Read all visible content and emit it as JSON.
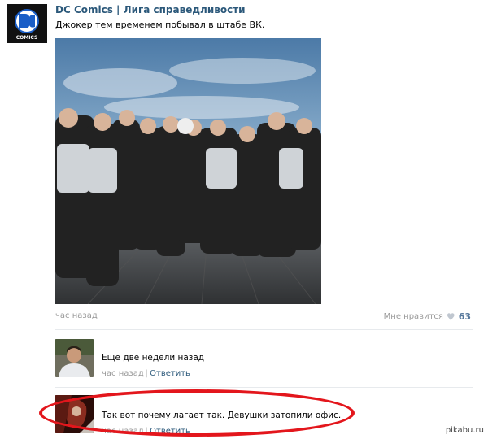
{
  "post": {
    "author": "DC Comics | Лига справедливости",
    "logo_text_1": "DC",
    "logo_text_2": "COMICS",
    "text": "Джокер тем временем побывал в штабе ВК.",
    "time": "час назад",
    "like_label": "Мне нравится",
    "like_count": "63",
    "photo_alt": "group-photo"
  },
  "comments": [
    {
      "text": "Еще две недели назад",
      "time": "час назад",
      "reply_label": "Ответить"
    },
    {
      "text": "Так вот почему лагает так. Девушки затопили офис.",
      "time": "час назад",
      "reply_label": "Ответить"
    }
  ],
  "watermark": "pikabu.ru",
  "colors": {
    "link": "#2b587a",
    "meta": "#999999",
    "highlight": "#e3161c"
  }
}
